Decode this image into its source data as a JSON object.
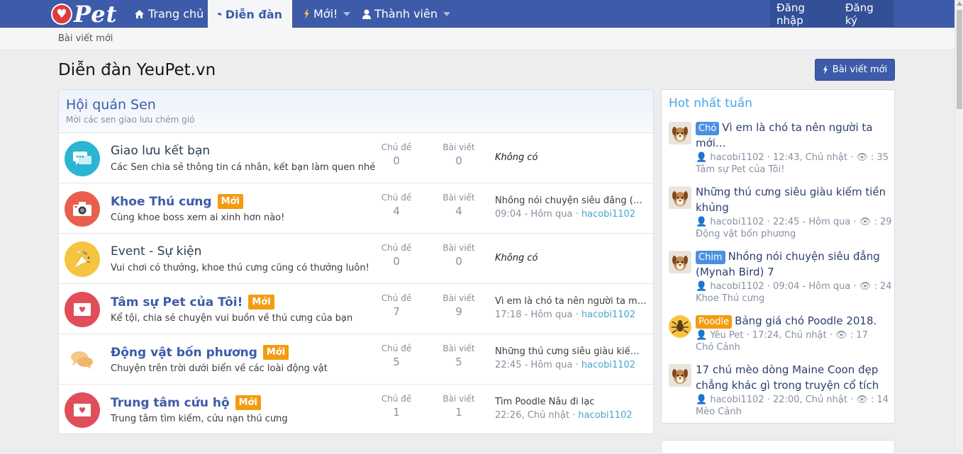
{
  "nav": {
    "logo": "Pet",
    "tabs": [
      {
        "label": "Trang chủ"
      },
      {
        "label": "Diễn đàn"
      },
      {
        "label": "Mới!"
      },
      {
        "label": "Thành viên"
      }
    ],
    "login": "Đăng nhập",
    "register": "Đăng ký"
  },
  "subnav": {
    "item": "Bài viết mới"
  },
  "page": {
    "title": "Diễn đàn YeuPet.vn",
    "new_post_button": "Bài viết mới"
  },
  "category": {
    "title": "Hội quán Sen",
    "description": "Mời các sen giao lưu chém gió"
  },
  "forums": [
    {
      "title": "Giao lưu kết bạn",
      "description": "Các Sen chia sẻ thông tin cá nhân, kết bạn làm quen nhé",
      "new_badge": "",
      "threads_label": "Chủ đề",
      "threads": "0",
      "posts_label": "Bài viết",
      "posts": "0",
      "latest_title": "Không có",
      "latest_time": "",
      "latest_user": ""
    },
    {
      "title": "Khoe Thú cưng",
      "description": "Cùng khoe boss xem ai xinh hơn nào!",
      "new_badge": "Mới",
      "threads_label": "Chủ đề",
      "threads": "4",
      "posts_label": "Bài viết",
      "posts": "4",
      "latest_title": "Nhồng nói chuyện siêu đẳng (M...",
      "latest_time": "09:04 - Hôm qua · ",
      "latest_user": "hacobi1102"
    },
    {
      "title": "Event - Sự kiện",
      "description": "Vui chơi có thưởng, khoe thú cưng cũng có thưởng luôn!",
      "new_badge": "",
      "threads_label": "Chủ đề",
      "threads": "0",
      "posts_label": "Bài viết",
      "posts": "0",
      "latest_title": "Không có",
      "latest_time": "",
      "latest_user": ""
    },
    {
      "title": "Tâm sự Pet của Tôi!",
      "description": "Kể tội, chia sẻ chuyện vui buồn về thú cưng của bạn",
      "new_badge": "Mới",
      "threads_label": "Chủ đề",
      "threads": "7",
      "posts_label": "Bài viết",
      "posts": "9",
      "latest_title": "Vì em là chó ta nên người ta mớ...",
      "latest_time": "17:18 - Hôm qua · ",
      "latest_user": "hacobi1102"
    },
    {
      "title": "Động vật bốn phương",
      "description": "Chuyện trên trời dưới biển về các loài động vật",
      "new_badge": "Mới",
      "threads_label": "Chủ đề",
      "threads": "5",
      "posts_label": "Bài viết",
      "posts": "5",
      "latest_title": "Những thú cưng siêu giàu kiếm ...",
      "latest_time": "22:45 - Hôm qua · ",
      "latest_user": "hacobi1102"
    },
    {
      "title": "Trung tâm cứu hộ",
      "description": "Trung tâm tìm kiếm, cứu nạn thú cưng",
      "new_badge": "Mới",
      "threads_label": "Chủ đề",
      "threads": "1",
      "posts_label": "Bài viết",
      "posts": "1",
      "latest_title": "Tìm Poodle Nâu đi lạc",
      "latest_time": "22:26, Chủ nhật · ",
      "latest_user": "hacobi1102"
    }
  ],
  "sidebar": {
    "title": "Hot nhất tuần",
    "items": [
      {
        "tag": "Chó",
        "title": "Vì em là chó ta nên người ta mới...",
        "meta": "hacobi1102 · 12:43, Chủ nhật · ",
        "views": ": 35",
        "forum": "Tâm sự Pet của Tôi!"
      },
      {
        "tag": "",
        "title": "Những thú cưng siêu giàu kiếm tiền khủng",
        "meta": "hacobi1102 · 22:45 - Hôm qua · ",
        "views": ": 29",
        "forum": "Động vật bốn phương"
      },
      {
        "tag": "Chim",
        "title": "Nhồng nói chuyện siêu đẳng (Mynah Bird) 7",
        "meta": "hacobi1102 · 09:04 - Hôm qua · ",
        "views": ": 24",
        "forum": "Khoe Thú cưng"
      },
      {
        "tag": "Poodle",
        "title": "Bảng giá chó Poodle 2018.",
        "meta": "Yêu Pet · 17:24, Chủ nhật · ",
        "views": ": 17",
        "forum": "Chó Cảnh"
      },
      {
        "tag": "",
        "title": "17 chú mèo dòng Maine Coon đẹp chẳng khác gì trong truyện cổ tích",
        "meta": "hacobi1102 · 22:00, Chủ nhật · ",
        "views": ": 14",
        "forum": "Mèo Cảnh"
      }
    ]
  },
  "colors": {
    "nav_bg": "#3d5ba8",
    "accent_link": "#47a7c8",
    "new_badge": "#f39c12",
    "tag_blue": "#4a90e2"
  }
}
